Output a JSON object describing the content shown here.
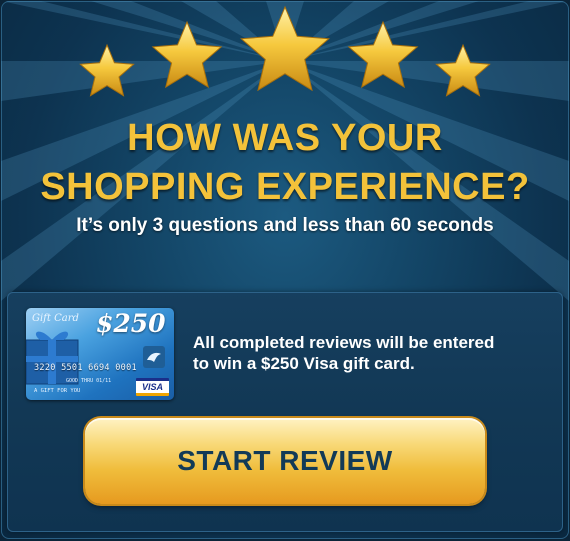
{
  "rating": {
    "stars": 5,
    "star_color": "#f3c23a"
  },
  "headline": {
    "line1": "HOW WAS YOUR",
    "line2": "SHOPPING EXPERIENCE?",
    "color": "#f3c23a"
  },
  "subline": "It’s only 3 questions and less than 60 seconds",
  "gift_card": {
    "label": "Gift Card",
    "amount": "$250",
    "card_number": "3220 5501 6694 0001",
    "good_thru": "GOOD THRU 01/11",
    "tagline": "A GIFT FOR YOU",
    "brand": "VISA"
  },
  "prize_text": {
    "line1": "All completed reviews will be entered",
    "line2": "to win a $250 Visa gift card."
  },
  "cta": {
    "label": "START REVIEW"
  },
  "colors": {
    "background": "#134566",
    "accent": "#f3c23a",
    "button": "#f0bd3c",
    "button_text": "#123a57"
  }
}
